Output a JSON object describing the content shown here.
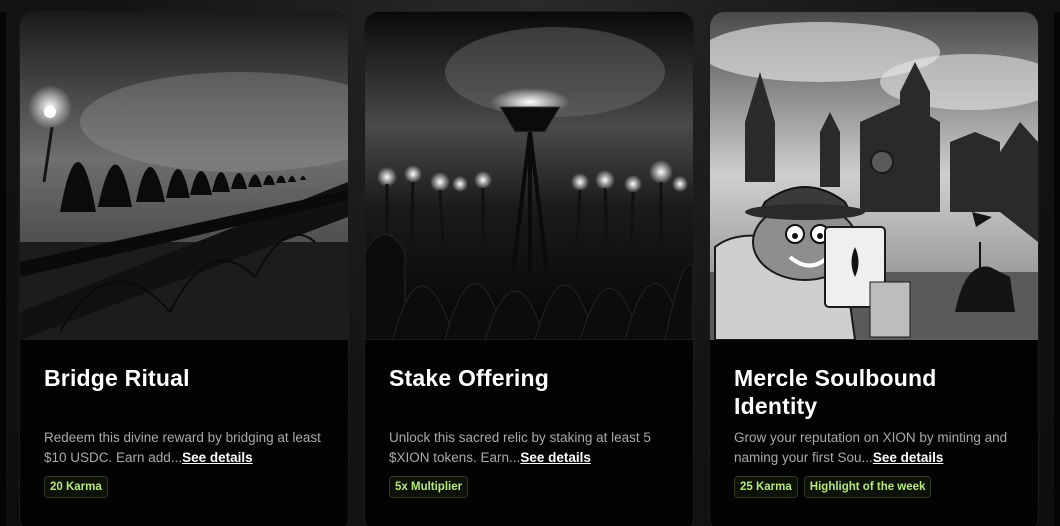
{
  "cards": [
    {
      "title": "Bridge Ritual",
      "description": "Redeem this divine reward by bridging at least $10 USDC. Earn add...",
      "details_link": "See details",
      "image": "hooded-figures-bridge-image",
      "tags": [
        "20 Karma"
      ]
    },
    {
      "title": "Stake Offering",
      "description": "Unlock this sacred relic by staking at least 5 $XION tokens. Earn...",
      "details_link": "See details",
      "image": "torch-crowd-image",
      "tags": [
        "5x Multiplier"
      ]
    },
    {
      "title": "Mercle Soulbound Identity",
      "description": "Grow your reputation on XION by minting and naming your first Sou...",
      "details_link": "See details",
      "image": "frog-castle-image",
      "tags": [
        "25 Karma",
        "Highlight of the week"
      ]
    }
  ],
  "colors": {
    "background": "#121212",
    "card": "#030303",
    "tag_text": "#b6e87a",
    "tag_border": "#2e3a24"
  }
}
